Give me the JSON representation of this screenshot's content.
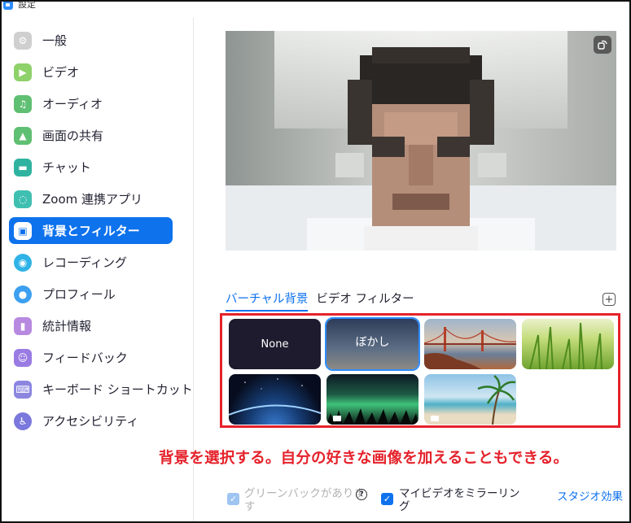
{
  "window": {
    "title": "設定"
  },
  "sidebar": {
    "items": [
      {
        "label": "一般",
        "icon": "gear-icon",
        "color": "#cfcfcf"
      },
      {
        "label": "ビデオ",
        "icon": "video-camera-icon",
        "color": "#8fd16a"
      },
      {
        "label": "オーディオ",
        "icon": "headphones-icon",
        "color": "#5fbf72"
      },
      {
        "label": "画面の共有",
        "icon": "share-screen-icon",
        "color": "#5fbf72"
      },
      {
        "label": "チャット",
        "icon": "chat-icon",
        "color": "#2fb3a0"
      },
      {
        "label": "Zoom 連携アプリ",
        "icon": "apps-icon",
        "color": "#3fbfb0"
      },
      {
        "label": "背景とフィルター",
        "icon": "background-icon",
        "color": "#ffffff",
        "active": true
      },
      {
        "label": "レコーディング",
        "icon": "record-icon",
        "color": "#2fb3e6"
      },
      {
        "label": "プロフィール",
        "icon": "profile-icon",
        "color": "#3d9ff0"
      },
      {
        "label": "統計情報",
        "icon": "statistics-icon",
        "color": "#b889e0"
      },
      {
        "label": "フィードバック",
        "icon": "feedback-icon",
        "color": "#9a7be3"
      },
      {
        "label": "キーボード ショートカット",
        "icon": "keyboard-icon",
        "color": "#8c86e0"
      },
      {
        "label": "アクセシビリティ",
        "icon": "accessibility-icon",
        "color": "#7a78dd"
      }
    ]
  },
  "tabs": {
    "virtual": "バーチャル背景",
    "filters": "ビデオ フィルター"
  },
  "backgrounds": {
    "none": "None",
    "blur": "ぼかし"
  },
  "annotation": "背景を選択する。自分の好きな画像を加えることもできる。",
  "bottom": {
    "green_screen": "グリーンバックがありま\nす",
    "mirror": "マイビデオをミラーリン\nグ",
    "studio": "スタジオ効果"
  },
  "colors": {
    "accent": "#0E72ED",
    "annotation": "#E5222B"
  }
}
